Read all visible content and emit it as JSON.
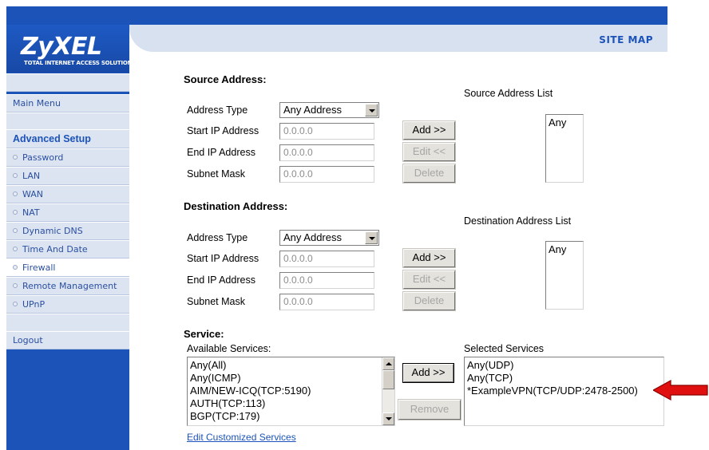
{
  "logo": {
    "title": "ZyXEL",
    "subtitle": "TOTAL INTERNET ACCESS SOLUTION"
  },
  "header": {
    "site_map": "SITE MAP"
  },
  "sidebar": {
    "main_menu": "Main Menu",
    "advanced_setup": "Advanced Setup",
    "items": [
      "Password",
      "LAN",
      "WAN",
      "NAT",
      "Dynamic DNS",
      "Time And Date",
      "Firewall",
      "Remote Management",
      "UPnP"
    ],
    "logout": "Logout"
  },
  "source": {
    "title": "Source Address:",
    "list_label": "Source Address List",
    "address_type_label": "Address Type",
    "address_type_value": "Any Address",
    "start_ip_label": "Start IP Address",
    "start_ip_value": "0.0.0.0",
    "end_ip_label": "End IP Address",
    "end_ip_value": "0.0.0.0",
    "subnet_label": "Subnet Mask",
    "subnet_value": "0.0.0.0",
    "add": "Add >>",
    "edit": "Edit <<",
    "delete": "Delete",
    "list": [
      "Any"
    ]
  },
  "destination": {
    "title": "Destination Address:",
    "list_label": "Destination Address List",
    "address_type_label": "Address Type",
    "address_type_value": "Any Address",
    "start_ip_label": "Start IP Address",
    "start_ip_value": "0.0.0.0",
    "end_ip_label": "End IP Address",
    "end_ip_value": "0.0.0.0",
    "subnet_label": "Subnet Mask",
    "subnet_value": "0.0.0.0",
    "add": "Add >>",
    "edit": "Edit <<",
    "delete": "Delete",
    "list": [
      "Any"
    ]
  },
  "service": {
    "title": "Service:",
    "available_label": "Available Services:",
    "selected_label": "Selected Services",
    "available": [
      "Any(All)",
      "Any(ICMP)",
      "AIM/NEW-ICQ(TCP:5190)",
      "AUTH(TCP:113)",
      "BGP(TCP:179)"
    ],
    "selected": [
      "Any(UDP)",
      "Any(TCP)",
      "*ExampleVPN(TCP/UDP:2478-2500)"
    ],
    "add": "Add >>",
    "remove": "Remove",
    "edit_link": "Edit Customized Services"
  },
  "colors": {
    "brand_blue": "#1c53b8",
    "arrow_red": "#e01010"
  }
}
